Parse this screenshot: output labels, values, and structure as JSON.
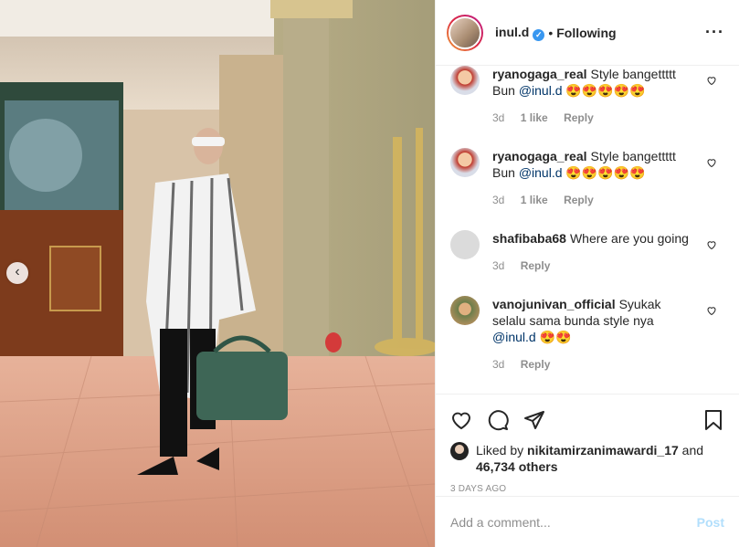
{
  "header": {
    "username": "inul.d",
    "verified": "✓",
    "separator": "•",
    "follow_status": "Following",
    "more": "···"
  },
  "comments": [
    {
      "user": "ryanogaga_real",
      "text": "Style bangettttt Bun ",
      "mention": "@inul.d",
      "emoji": " 😍😍😍😍😍",
      "time": "3d",
      "likes": "1 like",
      "reply": "Reply"
    },
    {
      "user": "ryanogaga_real",
      "text": "Style bangettttt Bun ",
      "mention": "@inul.d",
      "emoji": " 😍😍😍😍😍",
      "time": "3d",
      "likes": "1 like",
      "reply": "Reply"
    },
    {
      "user": "shafibaba68",
      "text": "Where are you going",
      "mention": "",
      "emoji": "",
      "time": "3d",
      "likes": "",
      "reply": "Reply"
    },
    {
      "user": "vanojunivan_official",
      "text": "Syukak selalu sama bunda style nya ",
      "mention": "@inul.d",
      "emoji": " 😍😍",
      "time": "3d",
      "likes": "",
      "reply": "Reply"
    }
  ],
  "likes": {
    "prefix": "Liked by ",
    "user": "nikitamirzanimawardi_17",
    "and": " and",
    "count": "46,734 others"
  },
  "date": "3 DAYS AGO",
  "add_comment": {
    "placeholder": "Add a comment...",
    "post_label": "Post"
  },
  "carousel": {
    "prev": "‹"
  },
  "colors": {
    "link": "#003569",
    "verified": "#3897f0",
    "post_disabled": "#b2dffc",
    "muted": "#8e8e8e"
  }
}
